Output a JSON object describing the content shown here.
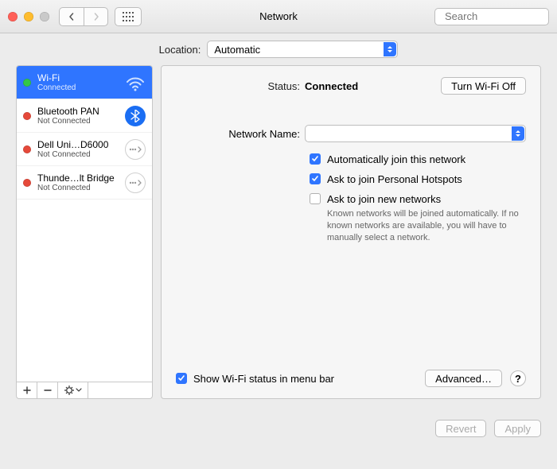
{
  "window": {
    "title": "Network"
  },
  "toolbar": {
    "search_placeholder": "Search"
  },
  "location": {
    "label": "Location:",
    "value": "Automatic"
  },
  "sidebar": {
    "items": [
      {
        "name": "Wi-Fi",
        "sub": "Connected",
        "status": "green",
        "icon": "wifi",
        "selected": true
      },
      {
        "name": "Bluetooth PAN",
        "sub": "Not Connected",
        "status": "red",
        "icon": "bluetooth"
      },
      {
        "name": "Dell Uni…D6000",
        "sub": "Not Connected",
        "status": "red",
        "icon": "cable"
      },
      {
        "name": "Thunde…lt Bridge",
        "sub": "Not Connected",
        "status": "red",
        "icon": "cable"
      }
    ]
  },
  "detail": {
    "status_label": "Status:",
    "status_value": "Connected",
    "wifi_off_btn": "Turn Wi-Fi Off",
    "network_name_label": "Network Name:",
    "network_name_value": "",
    "auto_join": "Automatically join this network",
    "ask_hotspot": "Ask to join Personal Hotspots",
    "ask_new": "Ask to join new networks",
    "help_text": "Known networks will be joined automatically. If no known networks are available, you will have to manually select a network.",
    "show_menu": "Show Wi-Fi status in menu bar",
    "advanced": "Advanced…",
    "question": "?"
  },
  "footer": {
    "revert": "Revert",
    "apply": "Apply"
  }
}
